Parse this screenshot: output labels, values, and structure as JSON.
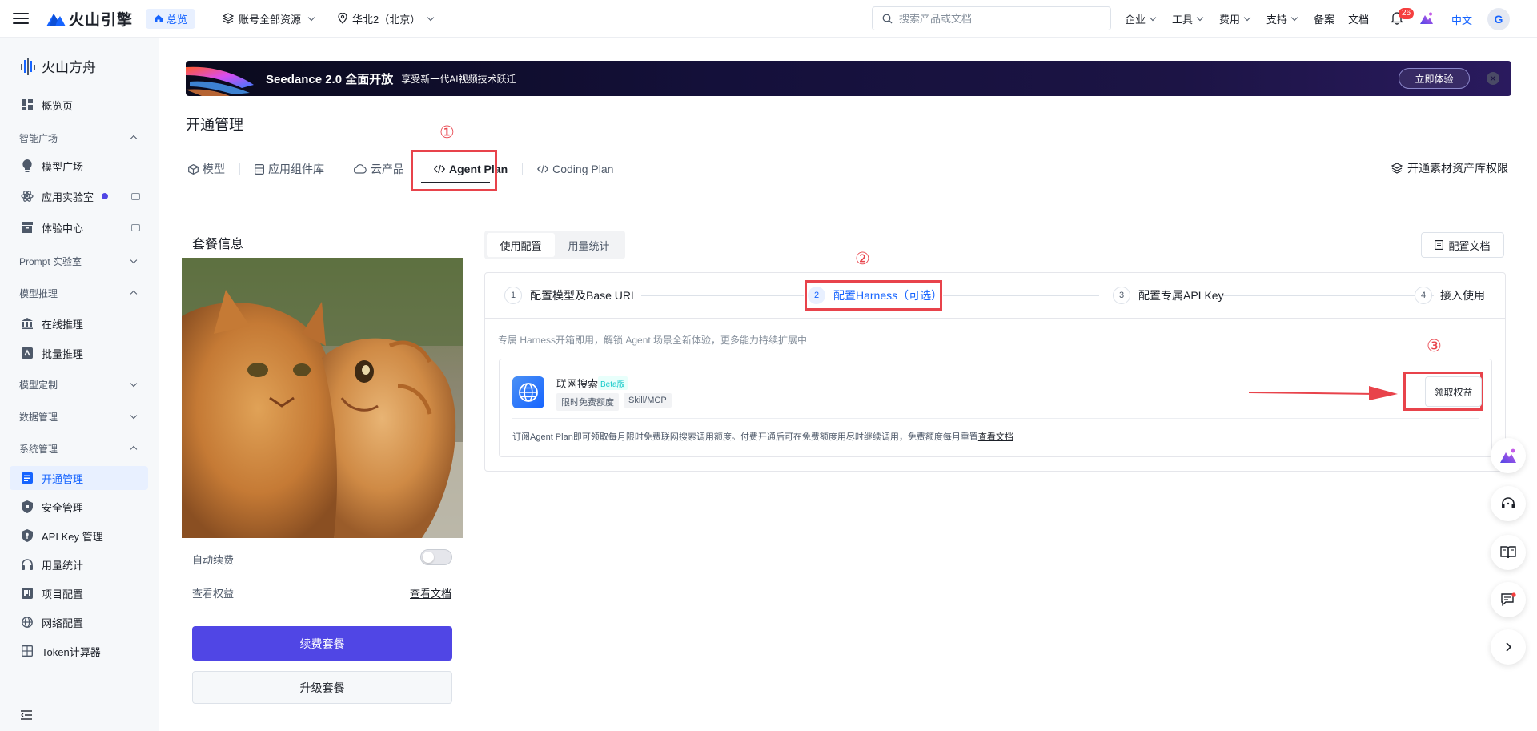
{
  "topbar": {
    "brand": "火山引擎",
    "home": "总览",
    "account_scope": "账号全部资源",
    "region": "华北2（北京）",
    "search_placeholder": "搜索产品或文档",
    "nav": [
      "企业",
      "工具",
      "费用",
      "支持",
      "备案",
      "文档"
    ],
    "notification_count": "26",
    "language": "中文",
    "avatar_initial": "G"
  },
  "sidebar": {
    "product": "火山方舟",
    "overview": "概览页",
    "groups": {
      "smart_plaza": "智能广场",
      "prompt_lab": "Prompt 实验室",
      "model_inference": "模型推理",
      "model_custom": "模型定制",
      "data_mgmt": "数据管理",
      "system_mgmt": "系统管理"
    },
    "items": {
      "model_plaza": "模型广场",
      "app_lab": "应用实验室",
      "experience": "体验中心",
      "online_infer": "在线推理",
      "batch_infer": "批量推理",
      "activation": "开通管理",
      "security": "安全管理",
      "api_key": "API Key 管理",
      "usage": "用量统计",
      "project": "项目配置",
      "network": "网络配置",
      "token_calc": "Token计算器"
    }
  },
  "banner": {
    "title": "Seedance 2.0 全面开放",
    "subtitle": "享受新一代AI视频技术跃迁",
    "button": "立即体验"
  },
  "page": {
    "title": "开通管理",
    "tabs": [
      "模型",
      "应用组件库",
      "云产品",
      "Agent Plan",
      "Coding Plan"
    ],
    "right_link": "开通素材资产库权限",
    "annotations": [
      "①",
      "②",
      "③"
    ]
  },
  "plan": {
    "title": "套餐信息",
    "auto_renew": "自动续费",
    "auto_renew_on": false,
    "view_rights": "查看权益",
    "view_doc": "查看文档",
    "renew_button": "续费套餐",
    "upgrade_button": "升级套餐"
  },
  "config": {
    "seg_tabs": [
      "使用配置",
      "用量统计"
    ],
    "doc_button": "配置文档",
    "steps": [
      {
        "num": "1",
        "label": "配置模型及Base URL"
      },
      {
        "num": "2",
        "label": "配置Harness（可选）"
      },
      {
        "num": "3",
        "label": "配置专属API Key"
      },
      {
        "num": "4",
        "label": "接入使用"
      }
    ],
    "note": "专属 Harness开箱即用，解锁 Agent 场景全新体验，更多能力持续扩展中",
    "card": {
      "name": "联网搜索",
      "beta": "Beta版",
      "chips": [
        "限时免费额度",
        "Skill/MCP"
      ],
      "claim_button": "领取权益",
      "footer": "订阅Agent Plan即可领取每月限时免费联网搜索调用额度。付费开通后可在免费额度用尽时继续调用，免费额度每月重置",
      "footer_link": "查看文档"
    }
  },
  "colors": {
    "primary": "#5046e5",
    "link": "#1664ff",
    "annotation_red": "#e8434b"
  }
}
